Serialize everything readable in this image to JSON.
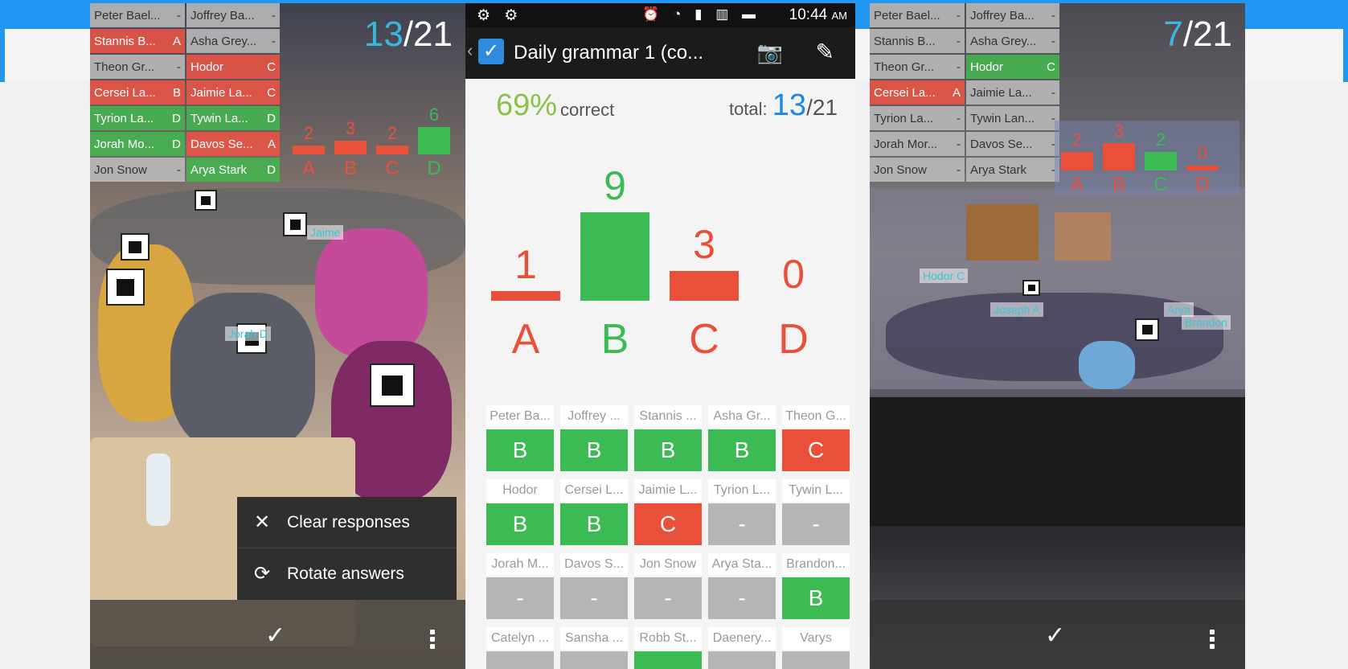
{
  "left_panel": {
    "count": "13",
    "total": "/21",
    "names": [
      {
        "name": "Peter Bael...",
        "ans": "-",
        "color": "gray"
      },
      {
        "name": "Joffrey Ba...",
        "ans": "-",
        "color": "gray"
      },
      {
        "name": "Stannis B...",
        "ans": "A",
        "color": "red"
      },
      {
        "name": "Asha Grey...",
        "ans": "-",
        "color": "gray"
      },
      {
        "name": "Theon Gr...",
        "ans": "-",
        "color": "gray"
      },
      {
        "name": "Hodor",
        "ans": "C",
        "color": "red"
      },
      {
        "name": "Cersei La...",
        "ans": "B",
        "color": "red"
      },
      {
        "name": "Jaimie La...",
        "ans": "C",
        "color": "red"
      },
      {
        "name": "Tyrion La...",
        "ans": "D",
        "color": "green"
      },
      {
        "name": "Tywin La...",
        "ans": "D",
        "color": "green"
      },
      {
        "name": "Jorah Mo...",
        "ans": "D",
        "color": "green"
      },
      {
        "name": "Davos Se...",
        "ans": "A",
        "color": "red"
      },
      {
        "name": "Jon Snow",
        "ans": "-",
        "color": "gray"
      },
      {
        "name": "Arya Stark",
        "ans": "D",
        "color": "green"
      }
    ],
    "mini_chart": {
      "values": [
        "2",
        "3",
        "2",
        "6"
      ],
      "letters": [
        "A",
        "B",
        "C",
        "D"
      ]
    },
    "float_labels": [
      "Jaime",
      "Jorah D"
    ],
    "menu": [
      {
        "icon": "✕",
        "label": "Clear responses"
      },
      {
        "icon": "⟳",
        "label": "Rotate answers"
      }
    ],
    "check": "✓"
  },
  "phone": {
    "status_time": "10:44",
    "status_ampm": "AM",
    "title": "Daily grammar 1 (co...",
    "percent": "69%",
    "percent_label": "correct",
    "total_label": "total:",
    "total_num": "13",
    "total_den": "/21",
    "chart_data": {
      "type": "bar",
      "categories": [
        "A",
        "B",
        "C",
        "D"
      ],
      "values": [
        1,
        9,
        3,
        0
      ],
      "correct": "B",
      "colors": {
        "correct": "#3cba54",
        "wrong": "#e8503a"
      }
    },
    "students": [
      {
        "name": "Peter Ba...",
        "ans": "B",
        "color": "green"
      },
      {
        "name": "Joffrey ...",
        "ans": "B",
        "color": "green"
      },
      {
        "name": "Stannis ...",
        "ans": "B",
        "color": "green"
      },
      {
        "name": "Asha Gr...",
        "ans": "B",
        "color": "green"
      },
      {
        "name": "Theon G...",
        "ans": "C",
        "color": "red"
      },
      {
        "name": "Hodor",
        "ans": "B",
        "color": "green"
      },
      {
        "name": "Cersei L...",
        "ans": "B",
        "color": "green"
      },
      {
        "name": "Jaimie L...",
        "ans": "C",
        "color": "red"
      },
      {
        "name": "Tyrion L...",
        "ans": "-",
        "color": "gray"
      },
      {
        "name": "Tywin L...",
        "ans": "-",
        "color": "gray"
      },
      {
        "name": "Jorah M...",
        "ans": "-",
        "color": "gray"
      },
      {
        "name": "Davos S...",
        "ans": "-",
        "color": "gray"
      },
      {
        "name": "Jon Snow",
        "ans": "-",
        "color": "gray"
      },
      {
        "name": "Arya Sta...",
        "ans": "-",
        "color": "gray"
      },
      {
        "name": "Brandon...",
        "ans": "B",
        "color": "green"
      },
      {
        "name": "Catelyn ...",
        "ans": "",
        "color": "gray"
      },
      {
        "name": "Sansha ...",
        "ans": "",
        "color": "gray"
      },
      {
        "name": "Robb St...",
        "ans": "",
        "color": "green"
      },
      {
        "name": "Daenery...",
        "ans": "",
        "color": "gray"
      },
      {
        "name": "Varys",
        "ans": "",
        "color": "gray"
      }
    ]
  },
  "right_panel": {
    "count": "7",
    "total": "/21",
    "names": [
      {
        "name": "Peter Bael...",
        "ans": "-",
        "color": "gray"
      },
      {
        "name": "Joffrey Ba...",
        "ans": "-",
        "color": "gray"
      },
      {
        "name": "Stannis B...",
        "ans": "-",
        "color": "gray"
      },
      {
        "name": "Asha Grey...",
        "ans": "-",
        "color": "gray"
      },
      {
        "name": "Theon Gr...",
        "ans": "-",
        "color": "gray"
      },
      {
        "name": "Hodor",
        "ans": "C",
        "color": "green"
      },
      {
        "name": "Cersei La...",
        "ans": "A",
        "color": "red"
      },
      {
        "name": "Jaimie La...",
        "ans": "-",
        "color": "gray"
      },
      {
        "name": "Tyrion La...",
        "ans": "-",
        "color": "gray"
      },
      {
        "name": "Tywin Lan...",
        "ans": "-",
        "color": "gray"
      },
      {
        "name": "Jorah Mor...",
        "ans": "-",
        "color": "gray"
      },
      {
        "name": "Davos Se...",
        "ans": "-",
        "color": "gray"
      },
      {
        "name": "Jon Snow",
        "ans": "-",
        "color": "gray"
      },
      {
        "name": "Arya Stark",
        "ans": "-",
        "color": "gray"
      }
    ],
    "mini_chart": {
      "values": [
        "2",
        "3",
        "2",
        "0"
      ],
      "letters": [
        "A",
        "B",
        "C",
        "D"
      ]
    },
    "float_labels": [
      "Hodor C",
      "Joseph A",
      "Brandon",
      "Arya"
    ],
    "check": "✓"
  },
  "colors": {
    "accent_blue": "#2196f3",
    "count_blue": "#3ab7e0",
    "green": "#3cba54",
    "red": "#e8503a",
    "gray": "#b5b5b5"
  }
}
